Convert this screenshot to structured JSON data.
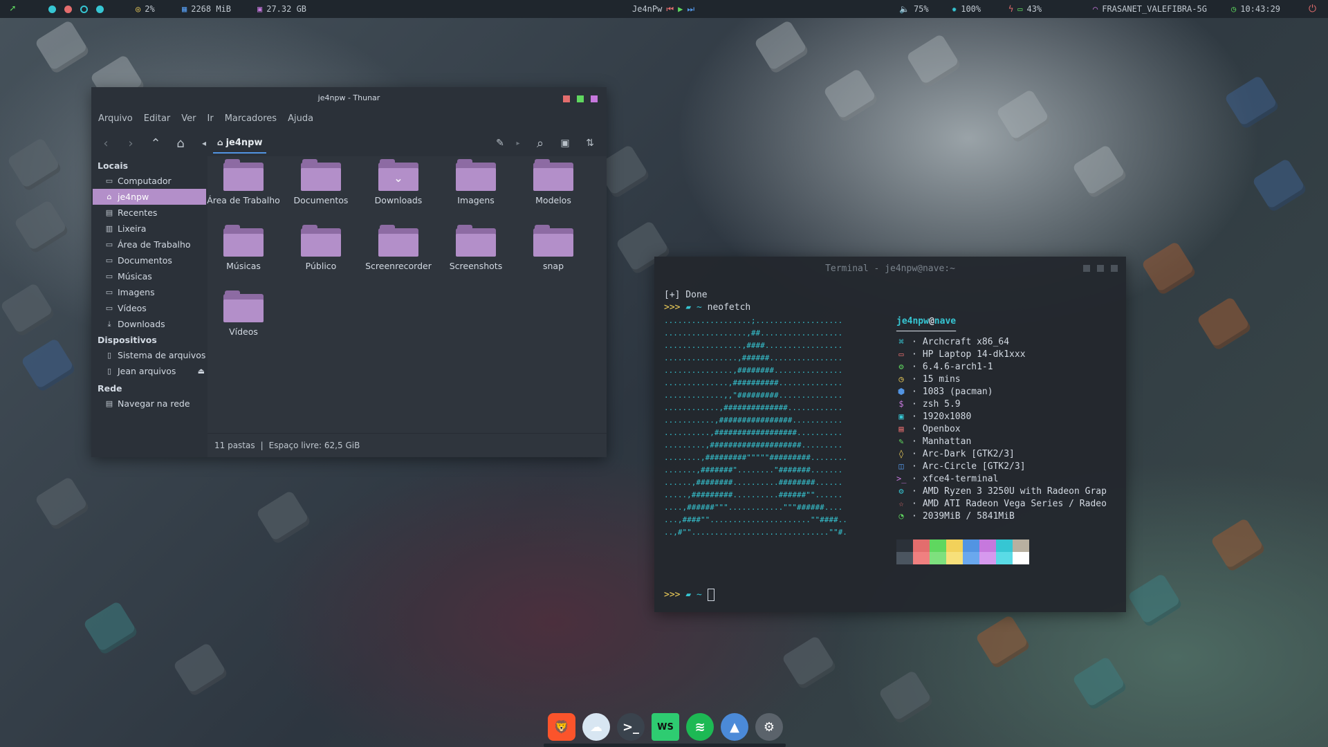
{
  "topbar": {
    "cpu": "2%",
    "ram": "2268 MiB",
    "disk": "27.32 GB",
    "media_title": "Je4nPw",
    "volume": "75%",
    "brightness": "100%",
    "battery": "43%",
    "wifi": "FRASANET_VALEFIBRA-5G",
    "clock": "10:43:29",
    "colors": [
      "#36c6d3",
      "#e36d6d",
      "#36c6d3",
      "#36c6d3"
    ]
  },
  "thunar": {
    "title": "je4npw - Thunar",
    "menu": [
      "Arquivo",
      "Editar",
      "Ver",
      "Ir",
      "Marcadores",
      "Ajuda"
    ],
    "path": "je4npw",
    "sidebar": {
      "locais_label": "Locais",
      "locais": [
        {
          "label": "Computador",
          "icon": "computer-icon"
        },
        {
          "label": "je4npw",
          "icon": "home-icon",
          "selected": true
        },
        {
          "label": "Recentes",
          "icon": "recent-icon"
        },
        {
          "label": "Lixeira",
          "icon": "trash-icon"
        },
        {
          "label": "Área de Trabalho",
          "icon": "folder-icon"
        },
        {
          "label": "Documentos",
          "icon": "folder-icon"
        },
        {
          "label": "Músicas",
          "icon": "folder-icon"
        },
        {
          "label": "Imagens",
          "icon": "folder-icon"
        },
        {
          "label": "Vídeos",
          "icon": "folder-icon"
        },
        {
          "label": "Downloads",
          "icon": "download-icon"
        }
      ],
      "dispositivos_label": "Dispositivos",
      "dispositivos": [
        {
          "label": "Sistema de arquivos",
          "icon": "drive-icon"
        },
        {
          "label": "Jean arquivos",
          "icon": "drive-icon"
        }
      ],
      "rede_label": "Rede",
      "rede": [
        {
          "label": "Navegar na rede",
          "icon": "network-icon"
        }
      ]
    },
    "folders": [
      "Área de Trabalho",
      "Documentos",
      "Downloads",
      "Imagens",
      "Modelos",
      "Músicas",
      "Público",
      "Screenrecorder",
      "Screenshots",
      "snap",
      "Vídeos"
    ],
    "status_count": "11 pastas",
    "status_sep": "|",
    "status_free": "Espaço livre: 62,5 GiB"
  },
  "terminal": {
    "title": "Terminal - je4npw@nave:~",
    "line1": "[+] Done",
    "prompt": ">>>",
    "tilde": "~",
    "command": "neofetch",
    "user": "je4npw",
    "at": "@",
    "host": "nave",
    "underline": "───────────",
    "ascii": [
      "...................;...................",
      "..................,##..................",
      ".................,####.................",
      "................,######................",
      "...............,########...............",
      "..............,##########..............",
      ".............,,\"#########..............",
      "............,##############............",
      "...........,################...........",
      "..........,##################..........",
      ".........,####################.........",
      "........,#########\"\"\"\"\"#########........",
      ".......,#######\"........\"#######.......",
      "......,########..........########......",
      ".....,#########..........######\"\"......",
      "....,######\"\"\"............\"\"\"######....",
      "...,####\"\"......................\"\"####..",
      "..,#\"\"..............................\"\"#."
    ],
    "info": [
      {
        "icon": "⌘",
        "color": "#36c6d3",
        "text": "Archcraft x86_64"
      },
      {
        "icon": "▭",
        "color": "#e36d6d",
        "text": "HP Laptop 14-dk1xxx"
      },
      {
        "icon": "⚙",
        "color": "#5fd75f",
        "text": "6.4.6-arch1-1"
      },
      {
        "icon": "◷",
        "color": "#f2d15a",
        "text": "15 mins"
      },
      {
        "icon": "⬢",
        "color": "#5294e2",
        "text": "1083 (pacman)"
      },
      {
        "icon": "$",
        "color": "#c678dd",
        "text": "zsh 5.9"
      },
      {
        "icon": "▣",
        "color": "#36c6d3",
        "text": "1920x1080"
      },
      {
        "icon": "▤",
        "color": "#e36d6d",
        "text": "Openbox"
      },
      {
        "icon": "✎",
        "color": "#5fd75f",
        "text": "Manhattan"
      },
      {
        "icon": "◊",
        "color": "#f2d15a",
        "text": "Arc-Dark [GTK2/3]"
      },
      {
        "icon": "◫",
        "color": "#5294e2",
        "text": "Arc-Circle [GTK2/3]"
      },
      {
        "icon": ">_",
        "color": "#c678dd",
        "text": "xfce4-terminal"
      },
      {
        "icon": "⚙",
        "color": "#36c6d3",
        "text": "AMD Ryzen 3 3250U with Radeon Grap"
      },
      {
        "icon": "☆",
        "color": "#e36d6d",
        "text": "AMD ATI Radeon Vega Series / Radeo"
      },
      {
        "icon": "◔",
        "color": "#5fd75f",
        "text": "2039MiB / 5841MiB"
      }
    ],
    "palette_top": [
      "#2b3139",
      "#e36d6d",
      "#5fd75f",
      "#f2d15a",
      "#5294e2",
      "#c678dd",
      "#36c6d3",
      "#b8b0a0"
    ],
    "palette_bottom": [
      "#4b5560",
      "#f08080",
      "#7ee07e",
      "#f7e07a",
      "#6aa8ee",
      "#d699ee",
      "#5adbe6",
      "#ffffff"
    ]
  },
  "dock": [
    {
      "name": "brave-icon",
      "bg": "#fb542b",
      "glyph": "🦁"
    },
    {
      "name": "files-icon",
      "bg": "#d8e6f2",
      "glyph": "☁"
    },
    {
      "name": "terminal-icon",
      "bg": "#3a434d",
      "glyph": ">_"
    },
    {
      "name": "webstorm-icon",
      "bg": "#2ecc71",
      "glyph": "WS"
    },
    {
      "name": "spotify-icon",
      "bg": "#1db954",
      "glyph": "≋"
    },
    {
      "name": "archcraft-icon",
      "bg": "#4b8ad8",
      "glyph": "▲"
    },
    {
      "name": "settings-icon",
      "bg": "#5b636b",
      "glyph": "⚙"
    }
  ]
}
